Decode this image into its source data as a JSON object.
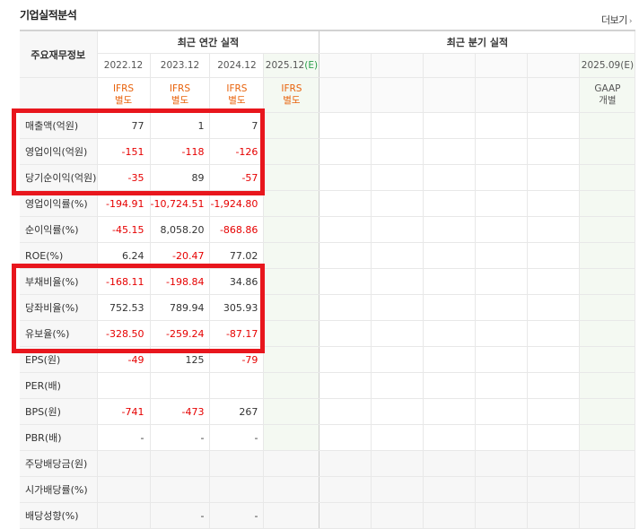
{
  "section_title": "기업실적분석",
  "more_label": "더보기",
  "more_arrow": "›",
  "header": {
    "row_label": "주요재무정보",
    "annual_group": "최근 연간 실적",
    "quarter_group": "최근 분기 실적",
    "annual_periods": [
      "2022.12",
      "2023.12",
      "2024.12",
      "2025.12(E)"
    ],
    "annual_est_suffix": "(E)",
    "quarter_last_period": "2025.09(E)",
    "annual_standards": [
      "IFRS 별도",
      "IFRS 별도",
      "IFRS 별도",
      "IFRS 별도"
    ],
    "quarter_last_standard": "GAAP 개별"
  },
  "rows": [
    {
      "label": "매출액(억원)",
      "values": [
        "77",
        "1",
        "7"
      ]
    },
    {
      "label": "영업이익(억원)",
      "values": [
        "-151",
        "-118",
        "-126"
      ]
    },
    {
      "label": "당기순이익(억원)",
      "values": [
        "-35",
        "89",
        "-57"
      ]
    },
    {
      "label": "영업이익률(%)",
      "values": [
        "-194.91",
        "-10,724.51",
        "-1,924.80"
      ]
    },
    {
      "label": "순이익률(%)",
      "values": [
        "-45.15",
        "8,058.20",
        "-868.86"
      ]
    },
    {
      "label": "ROE(%)",
      "values": [
        "6.24",
        "-20.47",
        "77.02"
      ]
    },
    {
      "label": "부채비율(%)",
      "values": [
        "-168.11",
        "-198.84",
        "34.86"
      ]
    },
    {
      "label": "당좌비율(%)",
      "values": [
        "752.53",
        "789.94",
        "305.93"
      ]
    },
    {
      "label": "유보율(%)",
      "values": [
        "-328.50",
        "-259.24",
        "-87.17"
      ]
    },
    {
      "label": "EPS(원)",
      "values": [
        "-49",
        "125",
        "-79"
      ]
    },
    {
      "label": "PER(배)",
      "values": [
        "",
        "",
        ""
      ]
    },
    {
      "label": "BPS(원)",
      "values": [
        "-741",
        "-473",
        "267"
      ]
    },
    {
      "label": "PBR(배)",
      "values": [
        "-",
        "-",
        "-"
      ]
    },
    {
      "label": "주당배당금(원)",
      "values": [
        "",
        "",
        ""
      ]
    },
    {
      "label": "시가배당률(%)",
      "values": [
        "",
        "",
        ""
      ]
    },
    {
      "label": "배당성향(%)",
      "values": [
        "",
        "-",
        "-"
      ]
    }
  ],
  "colors": {
    "negative": "#e60000",
    "highlight_box": "#e8161d",
    "ifrs": "#e8620b",
    "estimate": "#2a9d4a"
  }
}
